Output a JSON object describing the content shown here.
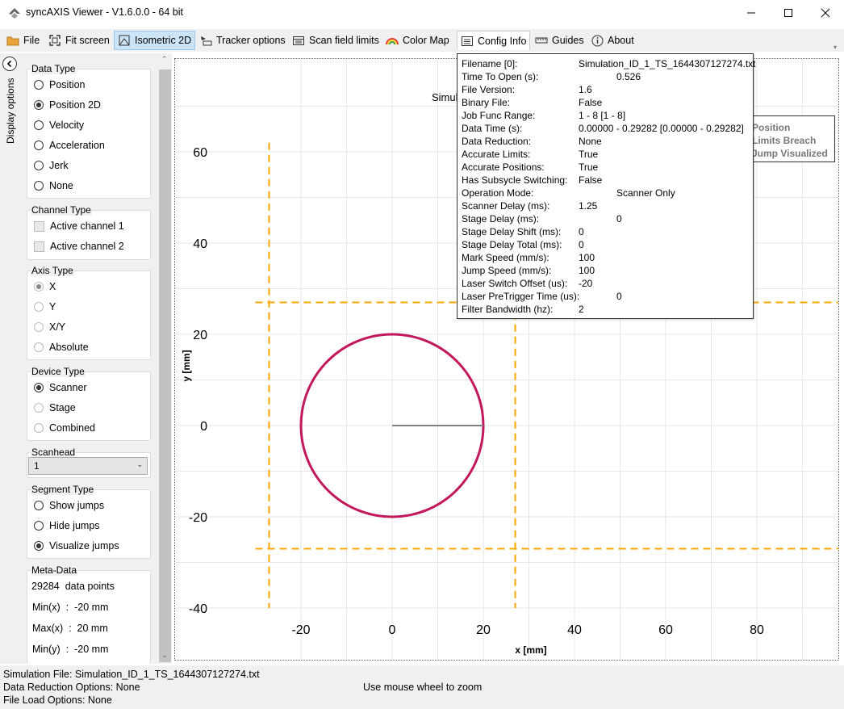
{
  "window": {
    "title": "syncAXIS Viewer - V1.6.0.0 - 64 bit"
  },
  "menu": {
    "file": "File",
    "fit_screen": "Fit screen",
    "isometric": "Isometric 2D",
    "tracker": "Tracker options",
    "scan_field": "Scan field limits",
    "color_map": "Color Map",
    "config_info": "Config Info",
    "guides": "Guides",
    "about": "About"
  },
  "sidebar": {
    "vertical_label": "Display options",
    "data_type": {
      "label": "Data Type",
      "options": [
        "Position",
        "Position 2D",
        "Velocity",
        "Acceleration",
        "Jerk",
        "None"
      ],
      "selected": "Position 2D"
    },
    "channel_type": {
      "label": "Channel Type",
      "options": [
        "Active channel 1",
        "Active channel 2"
      ]
    },
    "axis_type": {
      "label": "Axis Type",
      "options": [
        "X",
        "Y",
        "X/Y",
        "Absolute"
      ],
      "selected": "X"
    },
    "device_type": {
      "label": "Device Type",
      "options": [
        "Scanner",
        "Stage",
        "Combined"
      ],
      "selected": "Scanner"
    },
    "scanhead": {
      "label": "Scanhead",
      "value": "1"
    },
    "segment_type": {
      "label": "Segment Type",
      "options": [
        "Show jumps",
        "Hide jumps",
        "Visualize jumps"
      ],
      "selected": "Visualize jumps"
    },
    "meta": {
      "label": "Meta-Data",
      "rows": [
        "29284  data points",
        "Min(x)  :  -20 mm",
        "Max(x)  :  20 mm",
        "Min(y)  :  -20 mm"
      ]
    }
  },
  "plot": {
    "title_visible": "Simula",
    "legend": [
      "Position",
      "Limits Breach",
      "Jump Visualized"
    ]
  },
  "chart_data": {
    "type": "scatter",
    "xlabel": "x [mm]",
    "ylabel": "y [mm]",
    "xlim": [
      -30,
      95
    ],
    "ylim": [
      -42,
      66
    ],
    "x_ticks": [
      -20,
      0,
      20,
      40,
      60,
      80
    ],
    "y_ticks": [
      -40,
      -20,
      0,
      20,
      40,
      60
    ],
    "grid": true,
    "series": [
      {
        "name": "Position",
        "shape": "circle",
        "center": [
          0,
          0
        ],
        "radius": 20,
        "color": "#c2185b"
      },
      {
        "name": "Jump Visualized",
        "shape": "segment",
        "from": [
          0,
          0
        ],
        "to": [
          20,
          0
        ],
        "color": "#808080"
      }
    ],
    "limits": {
      "vertical": [
        -27,
        27
      ],
      "horizontal": [
        27,
        -27
      ],
      "color": "#ffa500"
    }
  },
  "config_info": {
    "rows": [
      [
        "Filename [0]:",
        "Simulation_ID_1_TS_1644307127274.txt"
      ],
      [
        "Time To Open (s):",
        "0.526"
      ],
      [
        "File Version:",
        "1.6"
      ],
      [
        "Binary File:",
        "False"
      ],
      [
        "Job Func Range:",
        "1 - 8 [1 - 8]"
      ],
      [
        "Data Time (s):",
        "0.00000 - 0.29282 [0.00000 - 0.29282]"
      ],
      [
        "Data Reduction:",
        "None"
      ],
      [
        "Accurate Limits:",
        "True"
      ],
      [
        "Accurate Positions:",
        "True"
      ],
      [
        "Has Subsycle Switching:",
        "False"
      ],
      [
        "Operation Mode:",
        "Scanner Only"
      ],
      [
        "Scanner Delay (ms):",
        "1.25"
      ],
      [
        "Stage Delay (ms):",
        "0"
      ],
      [
        "Stage Delay Shift (ms):",
        "0"
      ],
      [
        "Stage Delay Total (ms):",
        "0"
      ],
      [
        "Mark Speed (mm/s):",
        "100"
      ],
      [
        "Jump Speed (mm/s):",
        "100"
      ],
      [
        "Laser Switch Offset (us):",
        "-20"
      ],
      [
        "Laser PreTrigger Time (us):",
        "0"
      ],
      [
        "Filter Bandwidth (hz):",
        "2"
      ]
    ]
  },
  "status": {
    "sim_file": "Simulation File: Simulation_ID_1_TS_1644307127274.txt",
    "data_reduction": "Data Reduction Options: None",
    "load_options": "File Load Options:  None",
    "hint": "Use mouse wheel to zoom"
  }
}
